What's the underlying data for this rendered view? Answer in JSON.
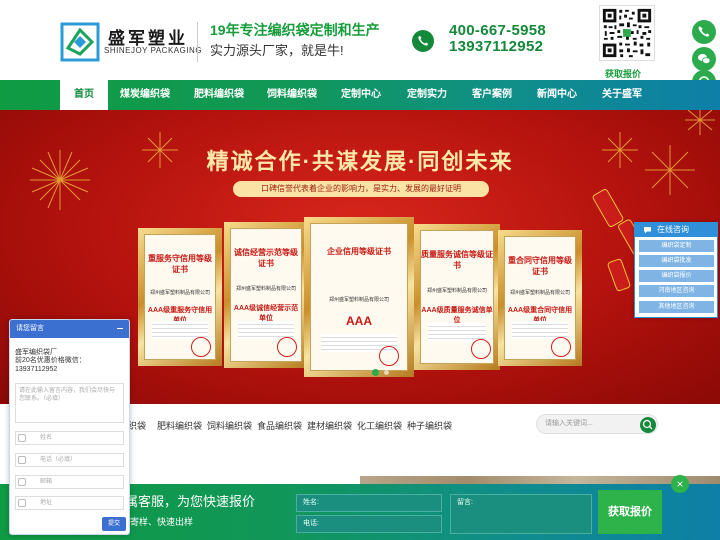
{
  "header": {
    "logo_cn": "盛军塑业",
    "logo_en": "SHINEJOY PACKAGING",
    "slogan_main": "19年专注编织袋定制和生产",
    "slogan_sub": "实力源头厂家，就是牛!",
    "phone_1": "400-667-5958",
    "phone_2": "13937112952",
    "qr_label": "获取报价",
    "brand_color": "#13893a"
  },
  "nav": {
    "items": [
      {
        "label": "首页",
        "active": true
      },
      {
        "label": "煤炭编织袋"
      },
      {
        "label": "肥料编织袋"
      },
      {
        "label": "饲料编织袋"
      },
      {
        "label": "定制中心"
      },
      {
        "label": "定制实力"
      },
      {
        "label": "客户案例"
      },
      {
        "label": "新闻中心"
      },
      {
        "label": "关于盛军"
      }
    ]
  },
  "banner": {
    "title": "精诚合作·共谋发展·同创未来",
    "subtitle": "口碑信誉代表着企业的影响力，是实力、发展的最好证明",
    "certificates": [
      {
        "title": "重服务守信用等级证书",
        "company": "郑州盛军塑料制品有限公司",
        "grade": "AAA级重服务守信用单位"
      },
      {
        "title": "诚信经营示范等级证书",
        "company": "郑州盛军塑料制品有限公司",
        "grade": "AAA级诚信经营示范单位"
      },
      {
        "title": "企业信用等级证书",
        "company": "郑州盛军塑料制品有限公司",
        "grade": "AAA"
      },
      {
        "title": "质量服务诚信等级证书",
        "company": "郑州盛军塑料制品有限公司",
        "grade": "AAA级质量服务诚信单位"
      },
      {
        "title": "重合同守信用等级证书",
        "company": "郑州盛军塑料制品有限公司",
        "grade": "AAA级重合同守信用单位"
      }
    ]
  },
  "consult": {
    "title": "在线咨询",
    "items": [
      "编织袋定制",
      "编织袋批发",
      "编织袋报价",
      "河南地区咨询",
      "其他地区咨询"
    ]
  },
  "categories": {
    "items": [
      "织袋",
      "肥料编织袋",
      "饲料编织袋",
      "食品编织袋",
      "建材编织袋",
      "化工编织袋",
      "种子编织袋"
    ],
    "search_placeholder": "请输入关键词..."
  },
  "bottom_bar": {
    "title": "专属客服，为您快速报价",
    "subtitle": "免费寄样、快速出样",
    "name_label": "姓名:",
    "phone_label": "电话:",
    "message_label": "留言:",
    "submit": "获取报价",
    "close": "×"
  },
  "message_widget": {
    "title": "请您留言",
    "org": "盛军编织袋厂",
    "desc": "前20名优惠价格微信：13937112952",
    "textarea_placeholder": "请在此输入留言内容，我们会尽快与您联系。（必填）",
    "name_placeholder": "姓名",
    "phone_placeholder": "电话（必填）",
    "email_placeholder": "邮箱",
    "address_placeholder": "地址",
    "submit": "提交"
  }
}
